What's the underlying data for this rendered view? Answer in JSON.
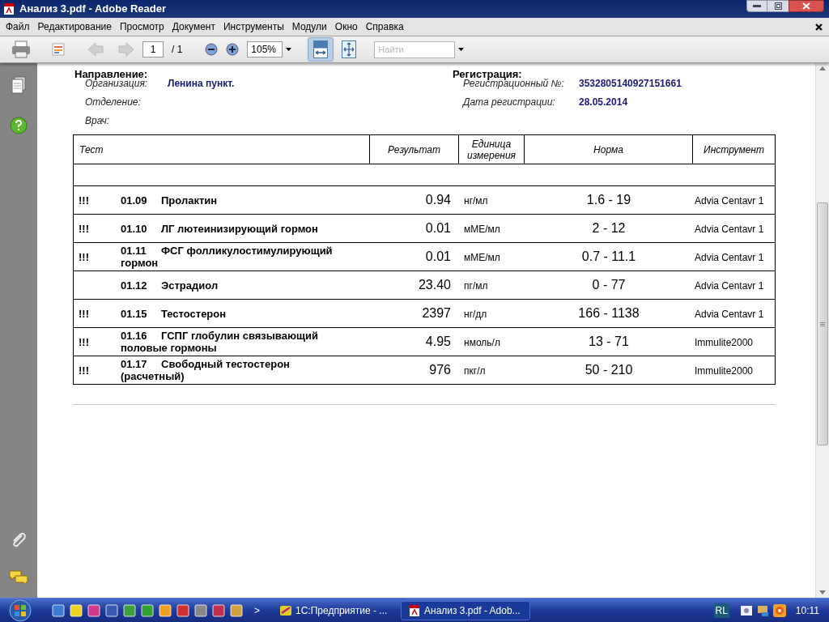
{
  "window": {
    "title": "Анализ 3.pdf - Adobe Reader"
  },
  "menu": [
    "Файл",
    "Редактирование",
    "Просмотр",
    "Документ",
    "Инструменты",
    "Модули",
    "Окно",
    "Справка"
  ],
  "toolbar": {
    "page": "1",
    "page_total": "/ 1",
    "zoom": "105%",
    "fit_width_selected": true,
    "search": {
      "placeholder": "Найти"
    }
  },
  "document": {
    "sections": [
      {
        "heading": "Направление:",
        "fields": [
          {
            "label": "Организация:",
            "value": "Ленина пункт."
          },
          {
            "label": "Отделение:"
          },
          {
            "label": "Врач:"
          }
        ]
      },
      {
        "heading": "Регистрация:",
        "fields": [
          {
            "label": "Регистрационный №:",
            "value": "3532805140927151661"
          },
          {
            "label": "Дата регистрации:",
            "value": "28.05.2014"
          }
        ]
      }
    ],
    "table": {
      "columns": [
        "Тест",
        "Результат",
        "Единица измерения",
        "Норма",
        "Инструмент"
      ],
      "rows": [
        {
          "flag": "!!!",
          "code": "01.09",
          "name": "Пролактин",
          "result": "0.94",
          "unit": "нг/мл",
          "norm": "1.6 - 19",
          "instrument": "Advia Centavr 1"
        },
        {
          "flag": "!!!",
          "code": "01.10",
          "name": "ЛГ лютеинизирующий гормон",
          "result": "0.01",
          "unit": "мМЕ/мл",
          "norm": "2 - 12",
          "instrument": "Advia Centavr 1"
        },
        {
          "flag": "!!!",
          "code": "01.11",
          "name": "ФСГ фолликулостимулирующий гормон",
          "result": "0.01",
          "unit": "мМЕ/мл",
          "norm": "0.7 - 11.1",
          "instrument": "Advia Centavr 1"
        },
        {
          "code": "01.12",
          "name": "Эстрадиол",
          "result": "23.40",
          "unit": "пг/мл",
          "norm": "0 - 77",
          "instrument": "Advia Centavr 1"
        },
        {
          "flag": "!!!",
          "code": "01.15",
          "name": "Тестостерон",
          "result": "2397",
          "unit": "нг/дл",
          "norm": "166 - 1138",
          "instrument": "Advia Centavr 1"
        },
        {
          "flag": "!!!",
          "code": "01.16",
          "name": "ГСПГ глобулин связывающий половые гормоны",
          "result": "4.95",
          "unit": "нмоль/л",
          "norm": "13 - 71",
          "instrument": "Immulite2000"
        },
        {
          "flag": "!!!",
          "code": "01.17",
          "name": "Свободный тестостерон (расчетный)",
          "result": "976",
          "unit": "пкг/л",
          "norm": "50 - 210",
          "instrument": "Immulite2000"
        }
      ]
    }
  },
  "taskbar": {
    "more": ">",
    "tasks": [
      {
        "label": "1С:Предприятие - ...",
        "selected": false,
        "kind": "onec"
      },
      {
        "label": "Анализ 3.pdf - Adob...",
        "selected": true,
        "kind": "pdf"
      }
    ],
    "language": "RL",
    "clock": "10:11"
  }
}
